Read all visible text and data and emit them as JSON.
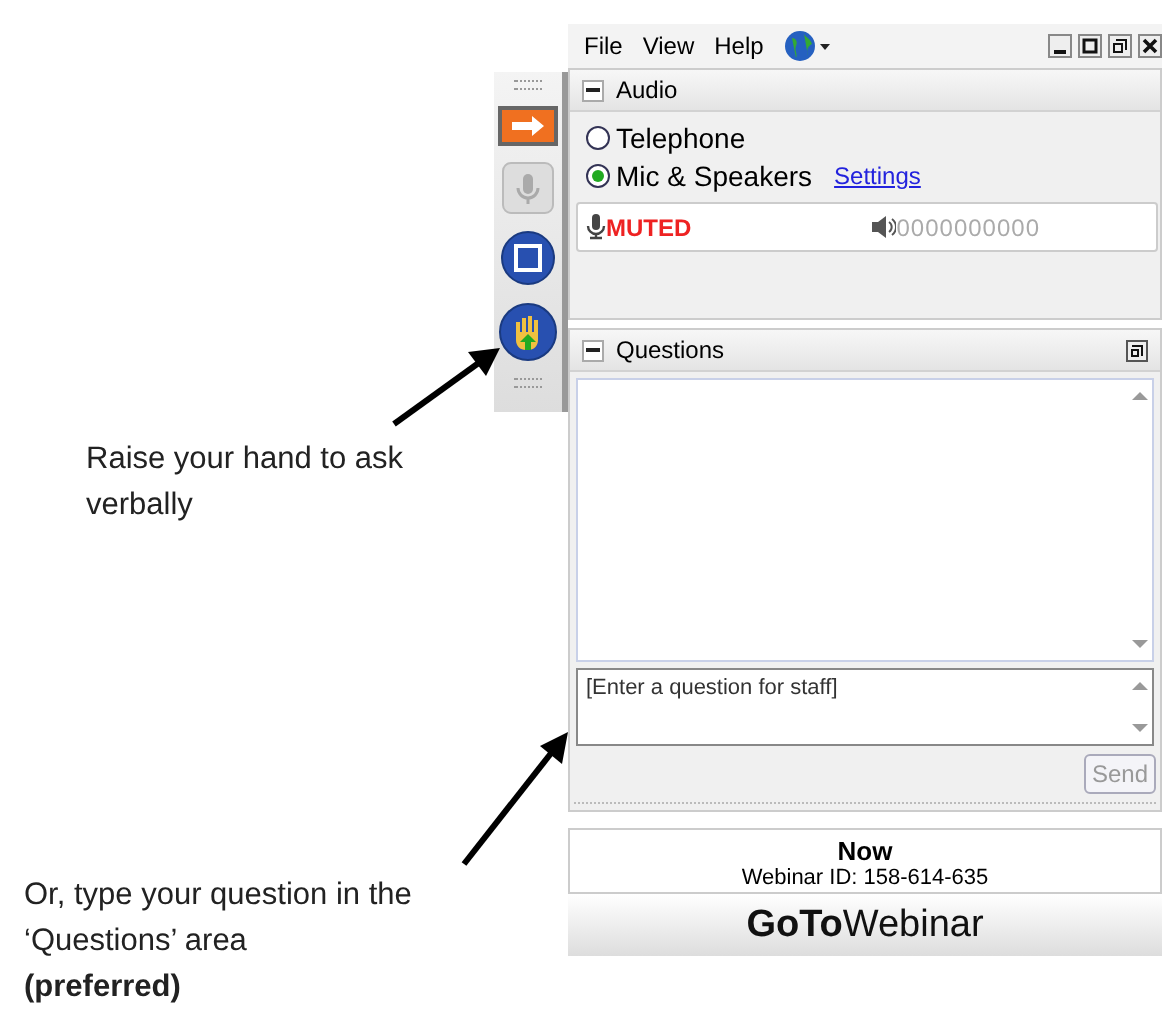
{
  "menu": [
    "File",
    "View",
    "Help"
  ],
  "audio": {
    "title": "Audio",
    "options": [
      {
        "label": "Telephone",
        "selected": false
      },
      {
        "label": "Mic & Speakers",
        "selected": true
      }
    ],
    "settings_link": "Settings",
    "mic_status": "MUTED",
    "speaker_meter": "0000000000"
  },
  "questions": {
    "title": "Questions",
    "placeholder": "[Enter a question for staff]",
    "send": "Send",
    "send_disabled": true
  },
  "session": {
    "status": "Now",
    "webinar_id": "Webinar ID: 158-614-635"
  },
  "brand": "**GoTo**Webinar",
  "annotations": [
    {
      "text": "Raise your hand to ask verbally"
    },
    {
      "text": "Or, type your question in the ‘Questions’ area",
      "emphasis": "(preferred)"
    }
  ]
}
